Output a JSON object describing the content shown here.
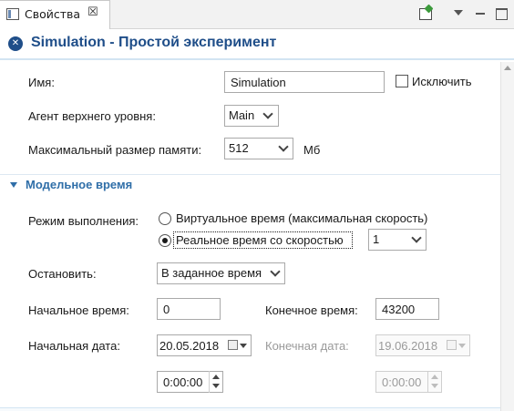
{
  "tab": {
    "label": "Свойства",
    "close": "☒"
  },
  "header": {
    "title": "Simulation - Простой эксперимент"
  },
  "general": {
    "name_label": "Имя:",
    "name_value": "Simulation",
    "exclude_label": "Исключить",
    "top_agent_label": "Агент верхнего уровня:",
    "top_agent_value": "Main",
    "max_memory_label": "Максимальный размер памяти:",
    "max_memory_value": "512",
    "max_memory_unit": "Мб"
  },
  "model_time": {
    "section_title": "Модельное время",
    "exec_mode_label": "Режим выполнения:",
    "option_virtual": "Виртуальное время (максимальная скорость)",
    "option_real": "Реальное время со скоростью",
    "selected_option": "real",
    "speed_value": "1",
    "stop_label": "Остановить:",
    "stop_value": "В заданное время",
    "start_time_label": "Начальное время:",
    "start_time_value": "0",
    "end_time_label": "Конечное время:",
    "end_time_value": "43200",
    "start_date_label": "Начальная дата:",
    "start_date_value": "20.05.2018",
    "end_date_label": "Конечная дата:",
    "end_date_value": "19.06.2018",
    "start_clock_value": "0:00:00",
    "end_clock_value": "0:00:00"
  },
  "icons": {
    "tab": "properties-icon",
    "header": "experiment-icon",
    "pin": "open-view-icon",
    "menu": "view-menu-icon",
    "minimize": "minimize-icon",
    "maximize": "maximize-icon"
  },
  "colors": {
    "accent": "#1f4e89",
    "section": "#2f6ea8",
    "disabled": "#9a9a9a"
  }
}
